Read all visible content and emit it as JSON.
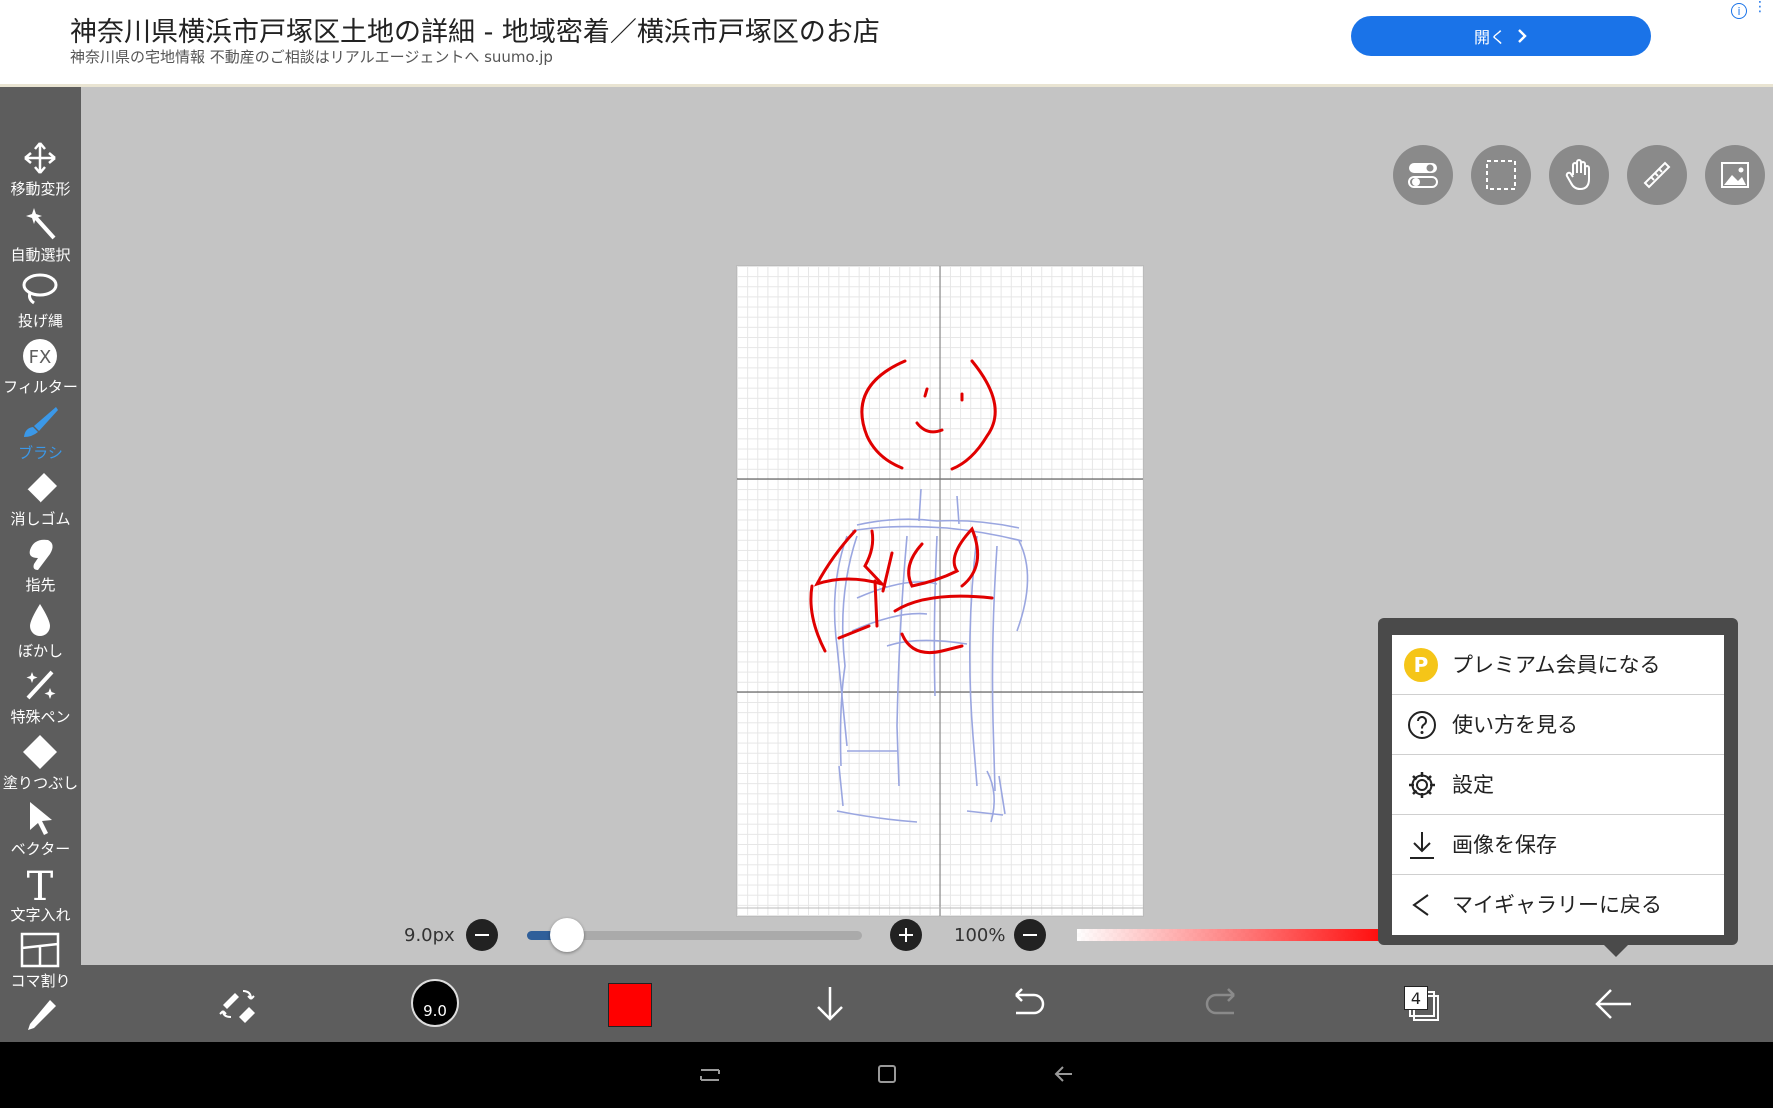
{
  "ad": {
    "title": "神奈川県横浜市戸塚区土地の詳細 - 地域密着／横浜市戸塚区のお店",
    "subtitle": "神奈川県の宅地情報 不動産のご相談はリアルエージェントへ suumo.jp",
    "button_label": "開く"
  },
  "left_toolbar": {
    "tools": [
      {
        "label": "移動変形",
        "icon": "move-icon"
      },
      {
        "label": "自動選択",
        "icon": "magic-wand-icon"
      },
      {
        "label": "投げ縄",
        "icon": "lasso-icon"
      },
      {
        "label": "フィルター",
        "icon": "fx-icon"
      },
      {
        "label": "ブラシ",
        "icon": "brush-icon"
      },
      {
        "label": "消しゴム",
        "icon": "eraser-icon"
      },
      {
        "label": "指先",
        "icon": "finger-icon"
      },
      {
        "label": "ぼかし",
        "icon": "blur-drop-icon"
      },
      {
        "label": "特殊ペン",
        "icon": "special-pen-icon"
      },
      {
        "label": "塗りつぶし",
        "icon": "fill-icon"
      },
      {
        "label": "ベクター",
        "icon": "vector-arrow-icon"
      },
      {
        "label": "文字入れ",
        "icon": "text-icon"
      },
      {
        "label": "コマ割り",
        "icon": "panel-icon"
      }
    ],
    "active_tool": "ブラシ",
    "fx_text": "FX",
    "text_glyph": "T"
  },
  "brush": {
    "size_label": "9.0px",
    "size_value": "9.0",
    "size_fraction": 0.12,
    "opacity_label": "100%",
    "color": "#ff0000"
  },
  "bottom_toolbar": {
    "layer_count": "4"
  },
  "menu": {
    "items": [
      {
        "label": "プレミアム会員になる",
        "icon": "premium-icon",
        "badge": "P"
      },
      {
        "label": "使い方を見る",
        "icon": "help-icon"
      },
      {
        "label": "設定",
        "icon": "gear-icon"
      },
      {
        "label": "画像を保存",
        "icon": "download-icon"
      },
      {
        "label": "マイギャラリーに戻る",
        "icon": "chevron-left-icon"
      }
    ]
  },
  "colors": {
    "accent": "#3b98e8",
    "toolbar": "#5d5d5d",
    "ad_button": "#1a73e8",
    "stroke_red": "#e00000",
    "sketch_blue": "#9aa6e0"
  }
}
